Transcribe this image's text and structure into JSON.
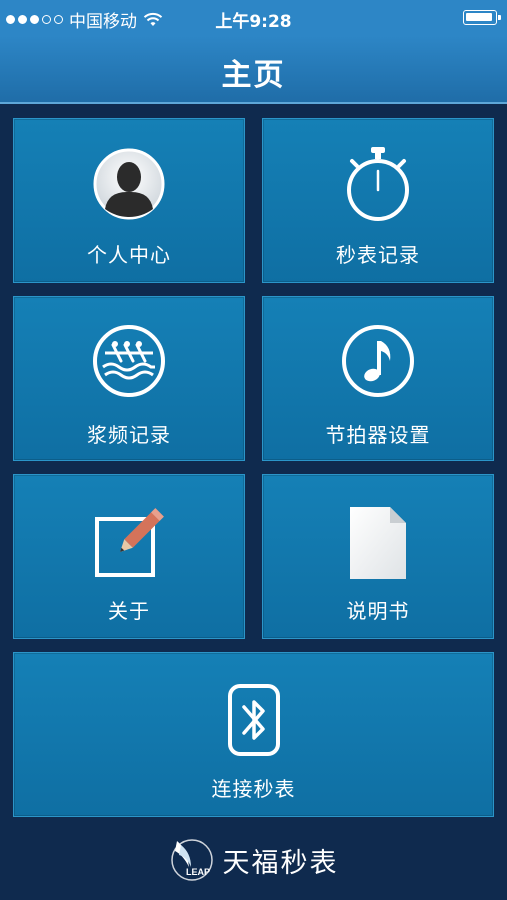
{
  "status_bar": {
    "carrier": "中国移动",
    "time": "上午9:28",
    "signal_bars": 3,
    "signal_total": 5
  },
  "header": {
    "title": "主页"
  },
  "tiles": [
    {
      "label": "个人中心",
      "icon": "user-avatar-icon"
    },
    {
      "label": "秒表记录",
      "icon": "stopwatch-icon"
    },
    {
      "label": "浆频记录",
      "icon": "rowing-icon"
    },
    {
      "label": "节拍器设置",
      "icon": "music-note-icon"
    },
    {
      "label": "关于",
      "icon": "edit-pencil-icon"
    },
    {
      "label": "说明书",
      "icon": "document-icon"
    },
    {
      "label": "连接秒表",
      "icon": "bluetooth-icon"
    }
  ],
  "footer": {
    "logo_text": "LEAP",
    "brand": "天福秒表"
  },
  "colors": {
    "background": "#0f2a4e",
    "header": "#2d86c6",
    "tile": "#1378ae",
    "pencil": "#d4735a"
  }
}
